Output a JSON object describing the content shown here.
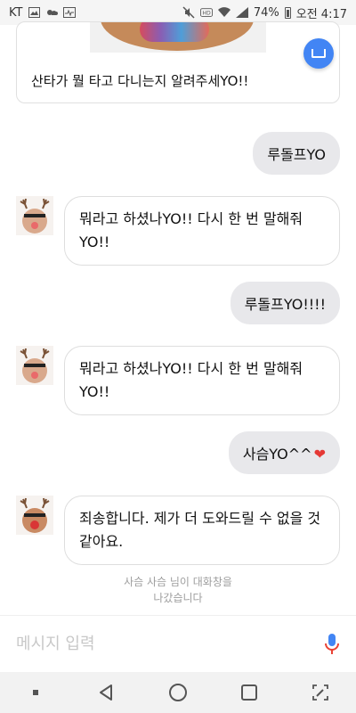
{
  "status_bar": {
    "carrier": "KT",
    "battery": "74%",
    "time": "오전 4:17"
  },
  "top_card": {
    "text": "산타가 뭘 타고 다니는지 알려주세YO!!"
  },
  "messages": {
    "user1": "루돌프YO",
    "bot1": "뭐라고 하셨나YO!! 다시 한 번 말해줘YO!!",
    "user2": "루돌프YO!!!!",
    "bot2": "뭐라고 하셨나YO!! 다시 한 번 말해줘YO!!",
    "user3": "사슴YO^^",
    "bot3": "죄송합니다. 제가 더 도와드릴 수 없을 것 같아요."
  },
  "left_notice": {
    "line1": "사슴 사슴 님이 대화창을",
    "line2": "나갔습니다"
  },
  "input": {
    "placeholder": "메시지 입력"
  },
  "icons": {
    "heart": "heart-icon",
    "mic": "mic-icon",
    "fab": "chat-bubble-icon",
    "nav": [
      "dot-icon",
      "back-icon",
      "home-icon",
      "recent-apps-icon",
      "edit-icon"
    ]
  },
  "colors": {
    "fab": "#4285f4",
    "user_bubble": "#e8e8eb",
    "heart": "#e53935",
    "mic_red": "#ea4335",
    "mic_blue": "#4285f4"
  }
}
